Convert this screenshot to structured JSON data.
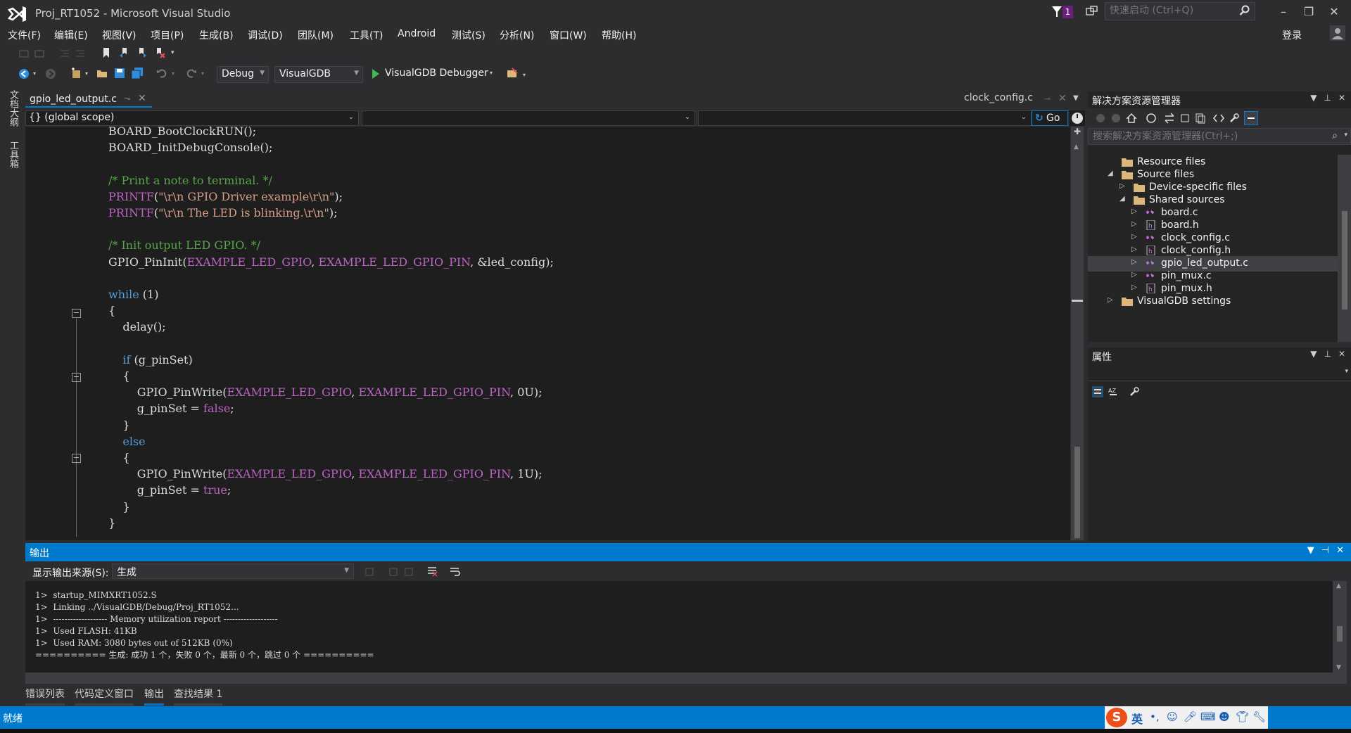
{
  "window": {
    "title": "Proj_RT1052 - Microsoft Visual Studio",
    "notification_count": "1",
    "quick_launch_placeholder": "快速启动 (Ctrl+Q)",
    "login": "登录"
  },
  "menu": [
    "文件(F)",
    "编辑(E)",
    "视图(V)",
    "项目(P)",
    "生成(B)",
    "调试(D)",
    "团队(M)",
    "工具(T)",
    "Android",
    "测试(S)",
    "分析(N)",
    "窗口(W)",
    "帮助(H)"
  ],
  "toolbar": {
    "config": "Debug",
    "platform": "VisualGDB",
    "debugger": "VisualGDB Debugger"
  },
  "side_tabs": [
    "文档大纲",
    "工具箱"
  ],
  "editor": {
    "active_tab": "gpio_led_output.c",
    "right_tab": "clock_config.c",
    "scope": "{} (global scope)",
    "go_label": "Go"
  },
  "code_lines": [
    {
      "indent": "",
      "parts": [
        [
          "t",
          "BOARD_BootClockRUN();"
        ]
      ]
    },
    {
      "indent": "",
      "parts": [
        [
          "t",
          "BOARD_InitDebugConsole();"
        ]
      ]
    },
    {
      "indent": "",
      "parts": []
    },
    {
      "indent": "",
      "parts": [
        [
          "cm",
          "/* Print a note to terminal. */"
        ]
      ]
    },
    {
      "indent": "",
      "parts": [
        [
          "mac",
          "PRINTF"
        ],
        [
          "t",
          "("
        ],
        [
          "str",
          "\"\\r\\n GPIO Driver example\\r\\n\""
        ],
        [
          "t",
          ");"
        ]
      ]
    },
    {
      "indent": "",
      "parts": [
        [
          "mac",
          "PRINTF"
        ],
        [
          "t",
          "("
        ],
        [
          "str",
          "\"\\r\\n The LED is blinking.\\r\\n\""
        ],
        [
          "t",
          ");"
        ]
      ]
    },
    {
      "indent": "",
      "parts": []
    },
    {
      "indent": "",
      "parts": [
        [
          "cm",
          "/* Init output LED GPIO. */"
        ]
      ]
    },
    {
      "indent": "",
      "parts": [
        [
          "t",
          "GPIO_PinInit("
        ],
        [
          "mac",
          "EXAMPLE_LED_GPIO"
        ],
        [
          "t",
          ", "
        ],
        [
          "mac",
          "EXAMPLE_LED_GPIO_PIN"
        ],
        [
          "t",
          ", &led_config);"
        ]
      ]
    },
    {
      "indent": "",
      "parts": []
    },
    {
      "indent": "",
      "parts": [
        [
          "kw",
          "while"
        ],
        [
          "t",
          " (1)"
        ]
      ]
    },
    {
      "indent": "",
      "parts": [
        [
          "t",
          "{"
        ]
      ]
    },
    {
      "indent": "    ",
      "parts": [
        [
          "t",
          "delay();"
        ]
      ]
    },
    {
      "indent": "",
      "parts": []
    },
    {
      "indent": "    ",
      "parts": [
        [
          "kw",
          "if"
        ],
        [
          "t",
          " (g_pinSet)"
        ]
      ]
    },
    {
      "indent": "    ",
      "parts": [
        [
          "t",
          "{"
        ]
      ]
    },
    {
      "indent": "        ",
      "parts": [
        [
          "t",
          "GPIO_PinWrite("
        ],
        [
          "mac",
          "EXAMPLE_LED_GPIO"
        ],
        [
          "t",
          ", "
        ],
        [
          "mac",
          "EXAMPLE_LED_GPIO_PIN"
        ],
        [
          "t",
          ", 0U);"
        ]
      ]
    },
    {
      "indent": "        ",
      "parts": [
        [
          "t",
          "g_pinSet = "
        ],
        [
          "lit",
          "false"
        ],
        [
          "t",
          ";"
        ]
      ]
    },
    {
      "indent": "    ",
      "parts": [
        [
          "t",
          "}"
        ]
      ]
    },
    {
      "indent": "    ",
      "parts": [
        [
          "kw",
          "else"
        ]
      ]
    },
    {
      "indent": "    ",
      "parts": [
        [
          "t",
          "{"
        ]
      ]
    },
    {
      "indent": "        ",
      "parts": [
        [
          "t",
          "GPIO_PinWrite("
        ],
        [
          "mac",
          "EXAMPLE_LED_GPIO"
        ],
        [
          "t",
          ", "
        ],
        [
          "mac",
          "EXAMPLE_LED_GPIO_PIN"
        ],
        [
          "t",
          ", 1U);"
        ]
      ]
    },
    {
      "indent": "        ",
      "parts": [
        [
          "t",
          "g_pinSet = "
        ],
        [
          "lit",
          "true"
        ],
        [
          "t",
          ";"
        ]
      ]
    },
    {
      "indent": "    ",
      "parts": [
        [
          "t",
          "}"
        ]
      ]
    },
    {
      "indent": "",
      "parts": [
        [
          "t",
          "}"
        ]
      ]
    }
  ],
  "solution_explorer": {
    "title": "解决方案资源管理器",
    "search_placeholder": "搜索解决方案资源管理器(Ctrl+;)",
    "items": [
      {
        "label": "Resource files",
        "kind": "folder",
        "level": 0,
        "expander": ""
      },
      {
        "label": "Source files",
        "kind": "folder",
        "level": 0,
        "expander": "◢"
      },
      {
        "label": "Device-specific files",
        "kind": "folder",
        "level": 1,
        "expander": "▷"
      },
      {
        "label": "Shared sources",
        "kind": "folder",
        "level": 1,
        "expander": "◢"
      },
      {
        "label": "board.c",
        "kind": "c",
        "level": 2,
        "expander": "▷"
      },
      {
        "label": "board.h",
        "kind": "h",
        "level": 2,
        "expander": "▷"
      },
      {
        "label": "clock_config.c",
        "kind": "c",
        "level": 2,
        "expander": "▷"
      },
      {
        "label": "clock_config.h",
        "kind": "h",
        "level": 2,
        "expander": "▷"
      },
      {
        "label": "gpio_led_output.c",
        "kind": "c",
        "level": 2,
        "expander": "▷",
        "selected": true
      },
      {
        "label": "pin_mux.c",
        "kind": "c",
        "level": 2,
        "expander": "▷"
      },
      {
        "label": "pin_mux.h",
        "kind": "h",
        "level": 2,
        "expander": "▷"
      },
      {
        "label": "VisualGDB settings",
        "kind": "folder",
        "level": 0,
        "expander": "▷"
      }
    ]
  },
  "properties": {
    "title": "属性"
  },
  "output": {
    "title": "输出",
    "source_label": "显示输出来源(S):",
    "source_value": "生成",
    "lines": [
      "1>  startup_MIMXRT1052.S",
      "1>  Linking ../VisualGDB/Debug/Proj_RT1052...",
      "1>  ------------------- Memory utilization report -------------------",
      "1>  Used FLASH: 41KB",
      "1>  Used RAM: 3080 bytes out of 512KB (0%)",
      "========== 生成: 成功 1 个，失败 0 个，最新 0 个，跳过 0 个 =========="
    ]
  },
  "bottom_tabs": [
    "错误列表",
    "代码定义窗口",
    "输出",
    "查找结果 1"
  ],
  "status": {
    "text": "就绪"
  },
  "ime": {
    "mode": "英"
  },
  "colors": {
    "accent": "#007acc",
    "keyword": "#569cd6",
    "comment": "#57a64a",
    "macro": "#bd63c5",
    "string": "#d69d85"
  }
}
